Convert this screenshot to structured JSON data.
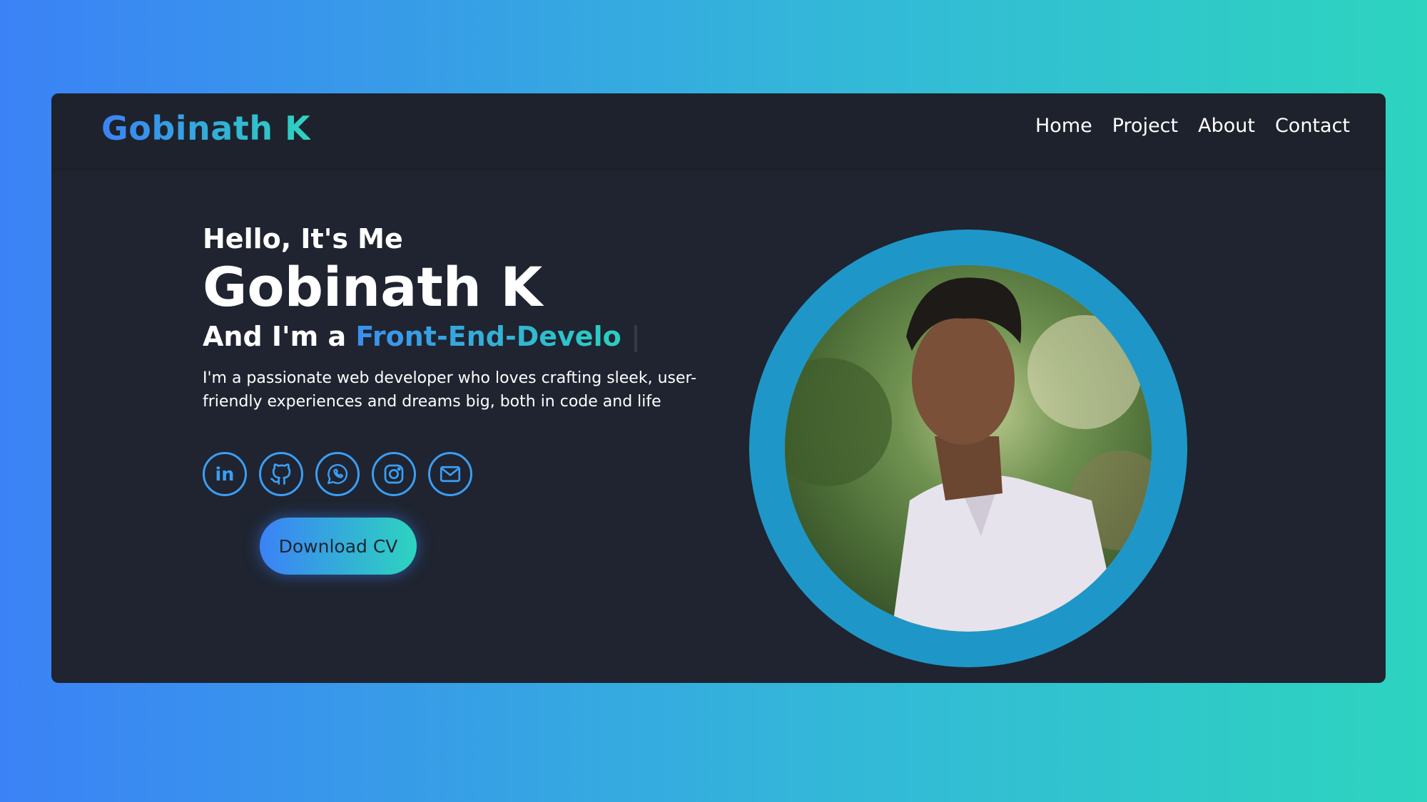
{
  "header": {
    "logo": "Gobinath K",
    "nav": [
      "Home",
      "Project",
      "About",
      "Contact"
    ]
  },
  "hero": {
    "greeting": "Hello, It's Me",
    "name": "Gobinath K",
    "role_prefix": "And I'm a",
    "role_typed": "Front-End-Develo",
    "bio": "I'm a passionate web developer who loves crafting sleek, user-friendly experiences and dreams big, both in code and life",
    "download_label": "Download CV"
  },
  "socials": [
    "linkedin-icon",
    "github-icon",
    "whatsapp-icon",
    "instagram-icon",
    "mail-icon"
  ],
  "colors": {
    "background": "#1f2430",
    "accent_start": "#3b82f6",
    "accent_end": "#2dd4bf",
    "ring": "#1e97c8"
  }
}
